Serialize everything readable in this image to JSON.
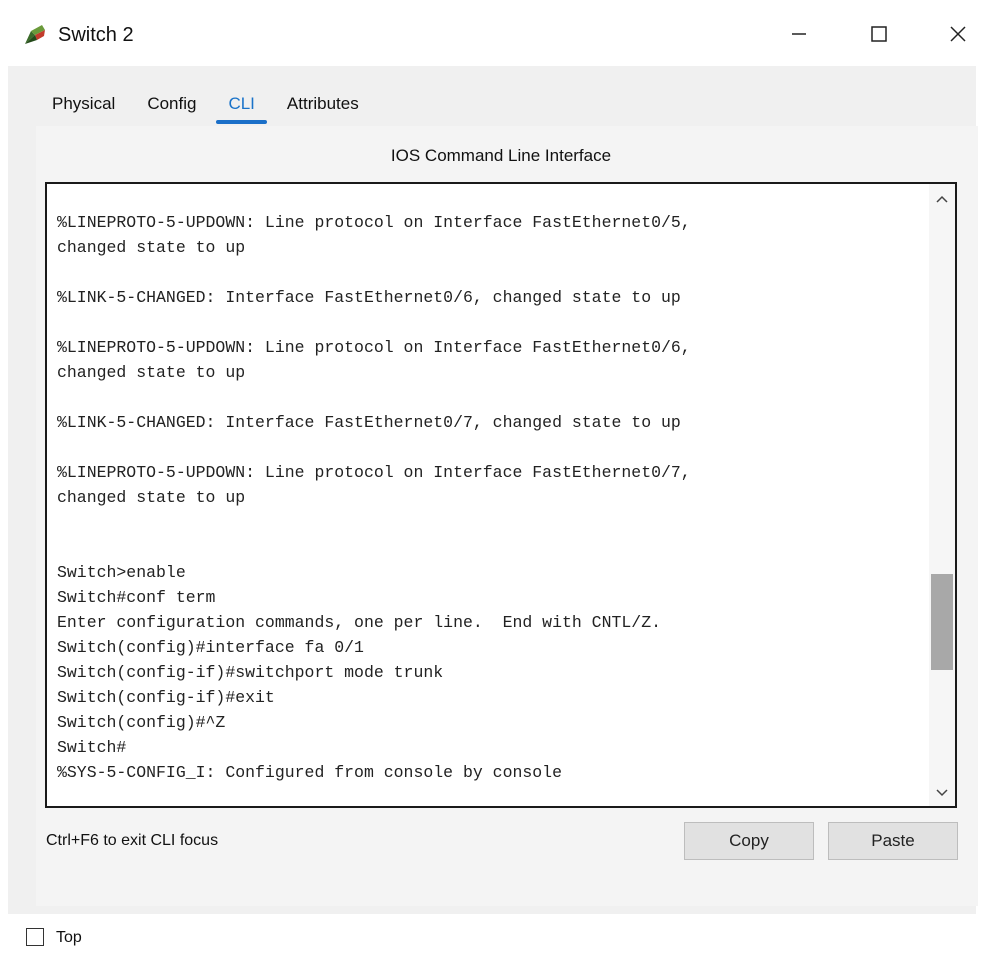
{
  "window": {
    "title": "Switch 2",
    "icon": "switch-device-icon",
    "controls": {
      "minimize_icon": "minimize-icon",
      "maximize_icon": "maximize-icon",
      "close_icon": "close-icon"
    }
  },
  "tabs": [
    {
      "label": "Physical",
      "active": false
    },
    {
      "label": "Config",
      "active": false
    },
    {
      "label": "CLI",
      "active": true
    },
    {
      "label": "Attributes",
      "active": false
    }
  ],
  "cli": {
    "heading": "IOS Command Line Interface",
    "lines": [
      "%LINEPROTO-5-UPDOWN: Line protocol on Interface FastEthernet0/5,",
      "changed state to up",
      "",
      "%LINK-5-CHANGED: Interface FastEthernet0/6, changed state to up",
      "",
      "%LINEPROTO-5-UPDOWN: Line protocol on Interface FastEthernet0/6,",
      "changed state to up",
      "",
      "%LINK-5-CHANGED: Interface FastEthernet0/7, changed state to up",
      "",
      "%LINEPROTO-5-UPDOWN: Line protocol on Interface FastEthernet0/7,",
      "changed state to up",
      "",
      "",
      "Switch>enable",
      "Switch#conf term",
      "Enter configuration commands, one per line.  End with CNTL/Z.",
      "Switch(config)#interface fa 0/1",
      "Switch(config-if)#switchport mode trunk",
      "Switch(config-if)#exit",
      "Switch(config)#^Z",
      "Switch#",
      "%SYS-5-CONFIG_I: Configured from console by console"
    ],
    "hint": "Ctrl+F6 to exit CLI focus",
    "copy_label": "Copy",
    "paste_label": "Paste"
  },
  "footer": {
    "checkbox_label": "Top",
    "checked": false
  },
  "colors": {
    "active_tab": "#1a73c9",
    "tab_underline": "#1a6fc8",
    "panel_bg": "#f0f0f0",
    "terminal_border": "#1a1a1a"
  }
}
